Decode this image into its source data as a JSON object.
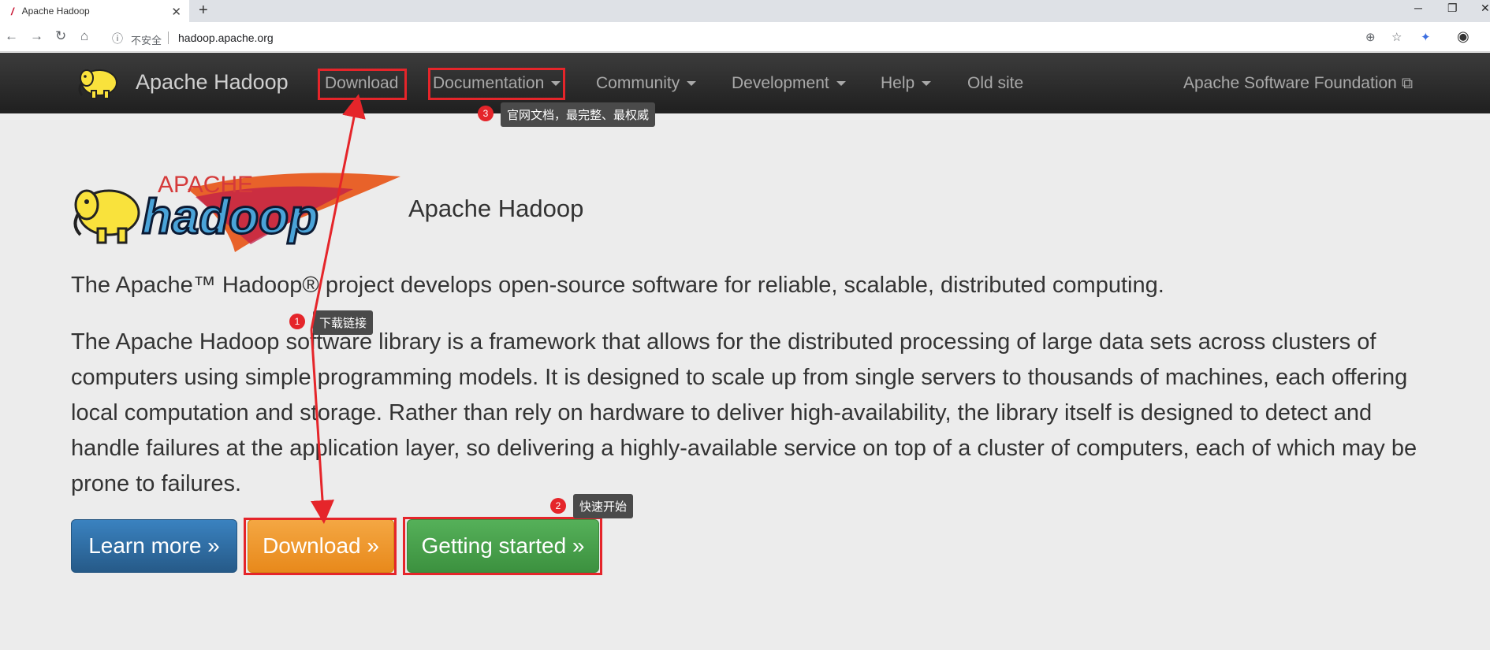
{
  "browser": {
    "tab_title": "Apache Hadoop",
    "tab_favicon": "hadoop-feather-icon",
    "security_label": "不安全",
    "url": "hadoop.apache.org"
  },
  "navbar": {
    "brand": "Apache Hadoop",
    "items": [
      {
        "label": "Download",
        "dropdown": false
      },
      {
        "label": "Documentation",
        "dropdown": true
      },
      {
        "label": "Community",
        "dropdown": true
      },
      {
        "label": "Development",
        "dropdown": true
      },
      {
        "label": "Help",
        "dropdown": true
      },
      {
        "label": "Old site",
        "dropdown": false
      }
    ],
    "external": "Apache Software Foundation"
  },
  "hero": {
    "logo_text_top": "APACHE",
    "logo_text_main": "hadoop",
    "title": "Apache Hadoop",
    "lead": "The Apache™ Hadoop® project develops open-source software for reliable, scalable, distributed computing.",
    "paragraph": "The Apache Hadoop software library is a framework that allows for the distributed processing of large data sets across clusters of computers using simple programming models. It is designed to scale up from single servers to thousands of machines, each offering local computation and storage. Rather than rely on hardware to deliver high-availability, the library itself is designed to detect and handle failures at the application layer, so delivering a highly-available service on top of a cluster of computers, each of which may be prone to failures.",
    "buttons": {
      "learn_more": "Learn more »",
      "download": "Download »",
      "getting_started": "Getting started »"
    }
  },
  "annotations": [
    {
      "num": "1",
      "text": "下载链接"
    },
    {
      "num": "2",
      "text": "快速开始"
    },
    {
      "num": "3",
      "text": "官网文档，最完整、最权威"
    }
  ],
  "colors": {
    "annotation_red": "#e5252a",
    "navbar_dark": "#2a2a2a",
    "btn_primary": "#2f6fa8",
    "btn_warning": "#ee9a2e",
    "btn_success": "#46a049"
  }
}
